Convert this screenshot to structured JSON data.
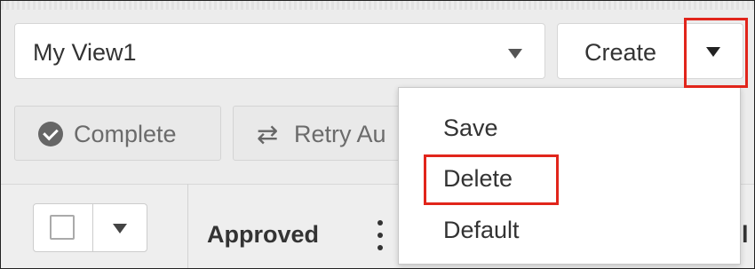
{
  "view_selector": {
    "value": "My View1"
  },
  "create_button": {
    "label": "Create"
  },
  "toolbar": {
    "complete_label": "Complete",
    "retry_label": "Retry Au"
  },
  "table": {
    "columns": [
      "Approved",
      "Fil"
    ]
  },
  "menu": {
    "items": [
      "Save",
      "Delete",
      "Default"
    ]
  },
  "icons": {
    "complete": "check-circle-icon",
    "retry": "retry-icon",
    "column_menu": "kebab-icon"
  },
  "colors": {
    "highlight": "#e1251b"
  }
}
